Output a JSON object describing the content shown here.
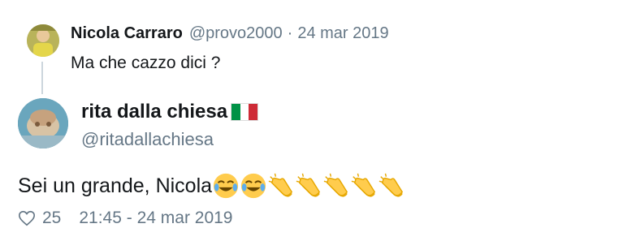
{
  "parent_tweet": {
    "author_name": "Nicola Carraro",
    "author_handle": "@provo2000",
    "separator": "·",
    "date": "24 mar 2019",
    "text": "Ma che cazzo dici ?"
  },
  "main_tweet": {
    "author_name": "rita dalla chiesa",
    "author_handle": "@ritadallachiesa",
    "text": "Sei un grande, Nicola",
    "emojis": [
      "tears-of-joy-icon",
      "tears-of-joy-icon",
      "clapping-hands-icon",
      "clapping-hands-icon",
      "clapping-hands-icon",
      "clapping-hands-icon",
      "clapping-hands-icon"
    ],
    "like_count": "25",
    "timestamp": "21:45 - 24 mar 2019"
  },
  "colors": {
    "text_primary": "#14171a",
    "text_secondary": "#657786",
    "thread_line": "#ccd6dd",
    "flag_green": "#009246",
    "flag_white": "#ffffff",
    "flag_red": "#ce2b37",
    "emoji_yellow": "#ffcc4d"
  }
}
